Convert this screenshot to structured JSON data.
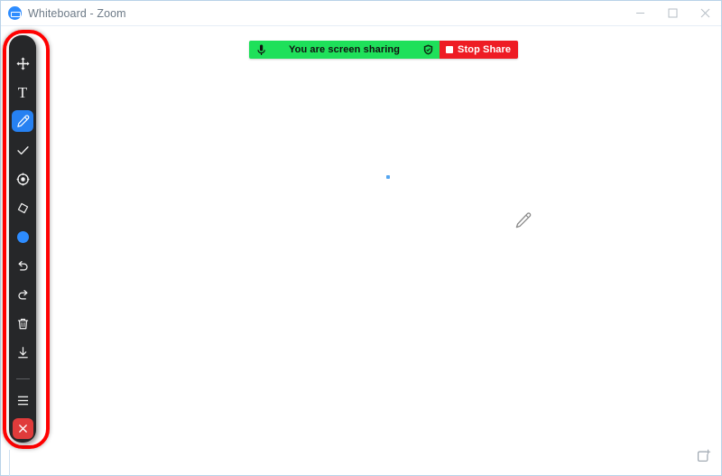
{
  "window": {
    "title": "Whiteboard - Zoom",
    "logo_icon": "zoom-logo-icon",
    "controls": [
      {
        "name": "minimize-button",
        "icon": "minimize-icon",
        "label": "Minimize"
      },
      {
        "name": "maximize-button",
        "icon": "maximize-icon",
        "label": "Maximize"
      },
      {
        "name": "close-button",
        "icon": "close-icon",
        "label": "Close"
      }
    ]
  },
  "share_bar": {
    "mic_icon": "microphone-icon",
    "status_text": "You are screen sharing",
    "shield_icon": "shield-icon",
    "stop_icon": "stop-square-icon",
    "stop_label": "Stop Share",
    "green_color": "#1EE05A",
    "red_color": "#EE1C24"
  },
  "toolbar": {
    "highlight_color": "#FF0000",
    "background_color": "#262729",
    "active_color": "#2681F2",
    "tools": [
      {
        "name": "move-tool",
        "icon": "move-arrows-icon",
        "label": "Move",
        "active": false
      },
      {
        "name": "text-tool",
        "icon": "text-t-icon",
        "label": "Text",
        "active": false
      },
      {
        "name": "draw-tool",
        "icon": "pencil-icon",
        "label": "Draw",
        "active": true
      },
      {
        "name": "stamp-tool",
        "icon": "checkmark-icon",
        "label": "Stamp",
        "active": false
      },
      {
        "name": "spotlight-tool",
        "icon": "spotlight-icon",
        "label": "Spotlight",
        "active": false
      },
      {
        "name": "eraser-tool",
        "icon": "eraser-icon",
        "label": "Eraser",
        "active": false
      },
      {
        "name": "color-swatch",
        "icon": "color-circle-icon",
        "label": "Color",
        "active": false,
        "color": "#2D8CFF"
      },
      {
        "name": "undo-button",
        "icon": "undo-arrow-icon",
        "label": "Undo",
        "active": false
      },
      {
        "name": "redo-button",
        "icon": "redo-arrow-icon",
        "label": "Redo",
        "active": false
      },
      {
        "name": "clear-button",
        "icon": "trash-icon",
        "label": "Clear",
        "active": false
      },
      {
        "name": "save-button",
        "icon": "download-icon",
        "label": "Save",
        "active": false
      }
    ],
    "menu": {
      "name": "menu-button",
      "icon": "hamburger-menu-icon",
      "label": "More"
    },
    "close": {
      "name": "close-toolbar-button",
      "icon": "close-x-icon",
      "label": "Close annotation",
      "color": "#E03B3B"
    }
  },
  "canvas": {
    "ink_mark_color": "#55A6F0",
    "cursor_icon": "pencil-cursor-icon",
    "new_page": {
      "name": "new-page-button",
      "icon": "add-page-icon",
      "label": "New page"
    }
  }
}
